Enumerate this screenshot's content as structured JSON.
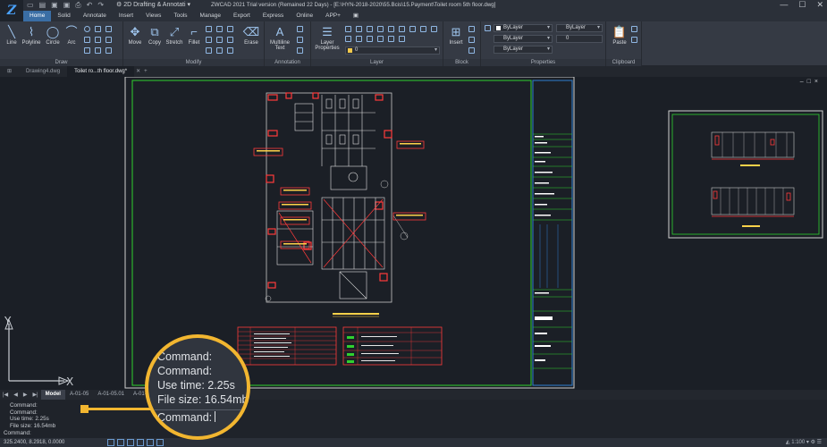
{
  "titlebar": {
    "workspace": "2D Drafting & Annotati",
    "title": "ZWCAD 2021 Trial version (Remained 22 Days) - [E:\\HYN-2018-2020\\55.Bcis\\15.Payment\\Toilet room 5th floor.dwg]"
  },
  "menu": {
    "tabs": [
      "Home",
      "Solid",
      "Annotate",
      "Insert",
      "Views",
      "Tools",
      "Manage",
      "Export",
      "Express",
      "Online",
      "APP+"
    ]
  },
  "ribbon": {
    "draw": {
      "title": "Draw",
      "tools": [
        "Line",
        "Polyline",
        "Circle",
        "Arc"
      ]
    },
    "modify": {
      "title": "Modify",
      "tools": [
        "Move",
        "Copy",
        "Stretch",
        "Fillet",
        "Erase"
      ]
    },
    "annotation": {
      "title": "Annotation",
      "tools": [
        "Multiline Text"
      ]
    },
    "layer": {
      "title": "Layer",
      "tools": [
        "Layer Properties"
      ],
      "current_layer": "0"
    },
    "block": {
      "title": "Block",
      "tools": [
        "Insert"
      ]
    },
    "properties": {
      "title": "Properties",
      "color": "ByLayer",
      "linetype": "ByLayer",
      "lineweight": "ByLayer",
      "plotstyle": "ByLayer",
      "value": "0"
    },
    "clipboard": {
      "title": "Clipboard",
      "tools": [
        "Paste"
      ]
    }
  },
  "doc_tabs": [
    "Drawing4.dwg",
    "Toilet ro...th floor.dwg*"
  ],
  "layout_tabs": [
    "Model",
    "A-01-05",
    "A-01-05.01",
    "A-01-05"
  ],
  "command_history": [
    "Command:",
    "Command:",
    "Use time: 2.25s",
    "File size: 16.54mb"
  ],
  "command_prompt": "Command:",
  "status": {
    "coords": "325.2400, 8.2918, 0.0000",
    "scale": "1:100"
  },
  "magnifier": {
    "lines": [
      "Command:",
      "Command:",
      "Use time: 2.25s",
      "File size: 16.54mb",
      "Command:"
    ]
  },
  "ucs": {
    "x_label": "X",
    "y_label": "Y"
  },
  "colors": {
    "accent": "#3a6ea5",
    "highlight": "#f2b630",
    "canvas": "#1b1f26"
  }
}
